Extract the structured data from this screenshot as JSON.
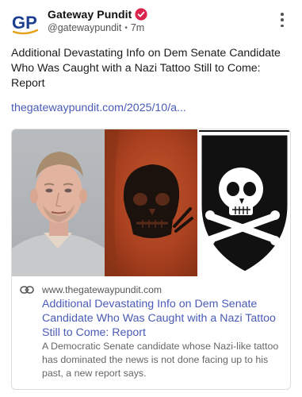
{
  "author": {
    "name": "Gateway Pundit",
    "handle": "@gatewaypundit",
    "separator": "•",
    "time": "7m",
    "avatar_text": "GP",
    "verified": true
  },
  "post": {
    "text": "Additional Devastating Info on Dem Senate Candidate Who Was Caught with a Nazi Tattoo Still to Come: Report",
    "link_text": "thegatewaypundit.com/2025/10/a..."
  },
  "card": {
    "domain": "www.thegatewaypundit.com",
    "title": "Additional Devastating Info on Dem Senate Candidate Who Was Caught with a Nazi Tattoo Still to Come: Report",
    "description": "A Democratic Senate candidate whose Nazi-like tattoo has dominated the news is not done facing up to his past, a new report says."
  },
  "icons": {
    "verified": "verified-badge-icon",
    "more": "more-vertical-icon",
    "link": "link-icon"
  },
  "colors": {
    "link": "#4a5bb8",
    "verified": "#d9244e",
    "avatar_blue": "#1c3f8f",
    "avatar_gold": "#e3a21a"
  }
}
